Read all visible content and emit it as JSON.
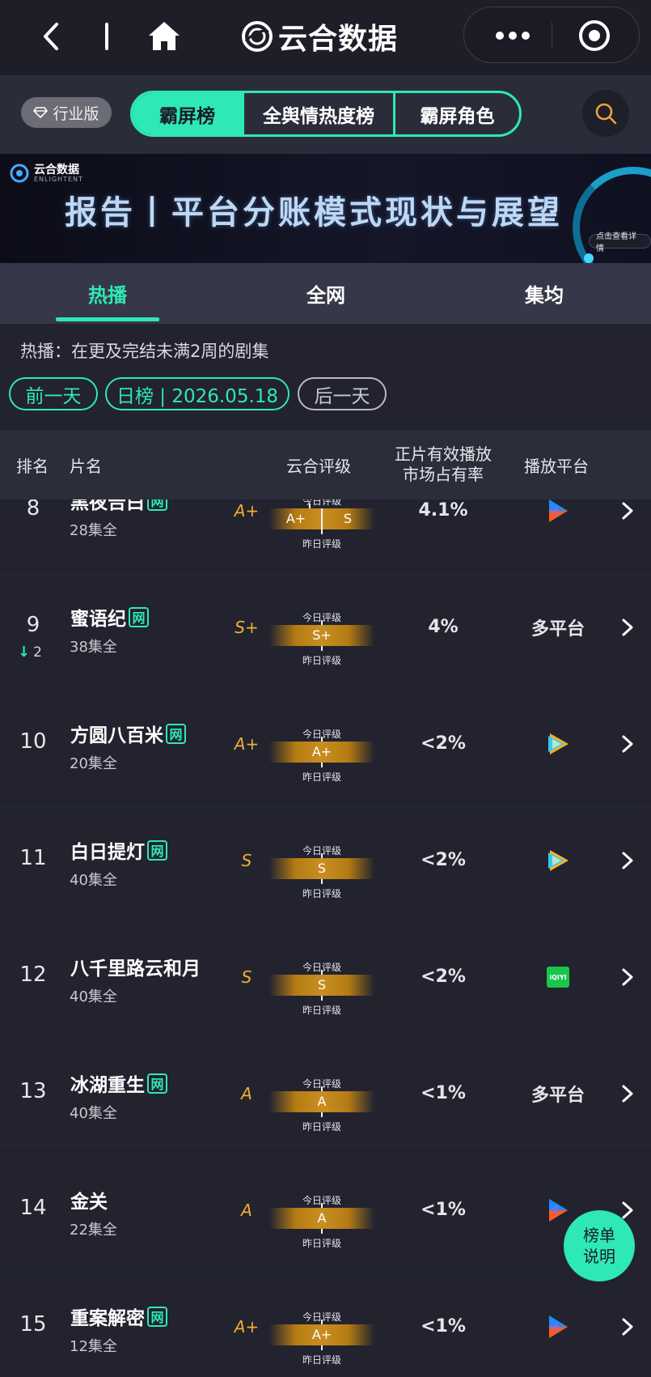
{
  "nav": {
    "brand": "云合数据",
    "icons": [
      "back-icon",
      "home-icon",
      "more-icon",
      "target-icon"
    ]
  },
  "tabstrip": {
    "edition": "行业版",
    "segments": [
      "霸屏榜",
      "全舆情热度榜",
      "霸屏角色"
    ],
    "active_segment": "霸屏榜"
  },
  "banner": {
    "logo": "云合数据",
    "logo_sub": "ENLIGHTENT",
    "title": "报告丨平台分账模式现状与展望",
    "pill": "点击查看详情"
  },
  "view_tabs": {
    "items": [
      "热播",
      "全网",
      "集均"
    ],
    "active": "热播"
  },
  "filter": {
    "description": "热播：在更及完结未满2周的剧集",
    "prev": "前一天",
    "date": "日榜 | 2026.05.18",
    "next": "后一天"
  },
  "table": {
    "headers": {
      "rank": "排名",
      "title": "片名",
      "grade": "云合评级",
      "share_line1": "正片有效播放",
      "share_line2": "市场占有率",
      "platform": "播放平台"
    },
    "scale_today": "今日评级",
    "scale_yesterday": "昨日评级",
    "rows": [
      {
        "rank": "8",
        "change": "",
        "title": "黑夜告白",
        "net": "网",
        "eps": "28集全",
        "grade": "A+",
        "today": "A+",
        "yesterday": "S",
        "share": "4.1%",
        "platform": "youku"
      },
      {
        "rank": "9",
        "change": "2",
        "title": "蜜语纪",
        "net": "网",
        "eps": "38集全",
        "grade": "S+",
        "today": "S+",
        "yesterday": "",
        "share": "4%",
        "platform": "多平台"
      },
      {
        "rank": "10",
        "change": "",
        "title": "方圆八百米",
        "net": "网",
        "eps": "20集全",
        "grade": "A+",
        "today": "A+",
        "yesterday": "",
        "share": "<2%",
        "platform": "tencent"
      },
      {
        "rank": "11",
        "change": "",
        "title": "白日提灯",
        "net": "网",
        "eps": "40集全",
        "grade": "S",
        "today": "S",
        "yesterday": "",
        "share": "<2%",
        "platform": "tencent"
      },
      {
        "rank": "12",
        "change": "",
        "title": "八千里路云和月",
        "net": "",
        "eps": "40集全",
        "grade": "S",
        "today": "S",
        "yesterday": "",
        "share": "<2%",
        "platform": "iqiyi"
      },
      {
        "rank": "13",
        "change": "",
        "title": "冰湖重生",
        "net": "网",
        "eps": "40集全",
        "grade": "A",
        "today": "A",
        "yesterday": "",
        "share": "<1%",
        "platform": "多平台"
      },
      {
        "rank": "14",
        "change": "",
        "title": "金关",
        "net": "",
        "eps": "22集全",
        "grade": "A",
        "today": "A",
        "yesterday": "",
        "share": "<1%",
        "platform": "youku"
      },
      {
        "rank": "15",
        "change": "",
        "title": "重案解密",
        "net": "网",
        "eps": "12集全",
        "grade": "A+",
        "today": "A+",
        "yesterday": "",
        "share": "<1%",
        "platform": "youku"
      }
    ]
  },
  "iqiyi_label": "iQIYI",
  "help": {
    "line1": "榜单",
    "line2": "说明"
  },
  "colors": {
    "accent": "#2ee8b5",
    "grade": "#f0b030",
    "background": "#22232f"
  }
}
